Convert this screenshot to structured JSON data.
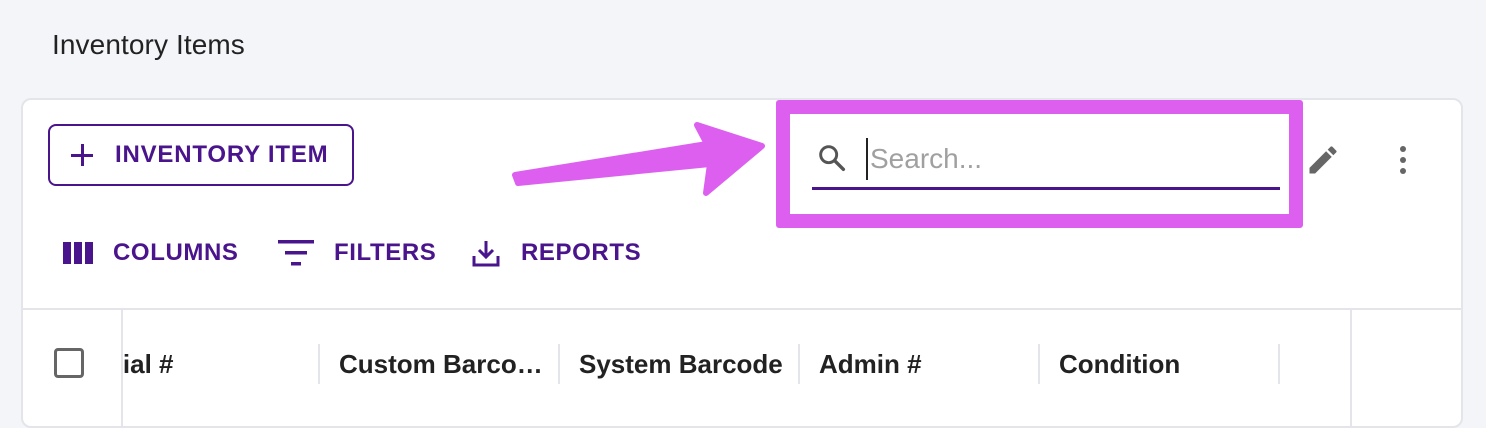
{
  "page": {
    "title": "Inventory Items"
  },
  "toolbar": {
    "add_label": "INVENTORY ITEM",
    "columns_label": "COLUMNS",
    "filters_label": "FILTERS",
    "reports_label": "REPORTS"
  },
  "search": {
    "placeholder": "Search...",
    "value": ""
  },
  "grid": {
    "columns": [
      {
        "label": "Serial #"
      },
      {
        "label": "Custom Barcode"
      },
      {
        "label": "System Barcode"
      },
      {
        "label": "Admin #"
      },
      {
        "label": "Condition"
      }
    ]
  },
  "annotation": {
    "highlight_color": "#dd5ff0"
  },
  "colors": {
    "accent": "#4a148c",
    "background": "#f4f5f9",
    "icon_gray": "#666666"
  },
  "icons": {
    "add": "plus-icon",
    "columns": "columns-icon",
    "filters": "filter-icon",
    "reports": "download-icon",
    "search": "search-icon",
    "edit": "pencil-icon",
    "more": "more-vertical-icon"
  }
}
